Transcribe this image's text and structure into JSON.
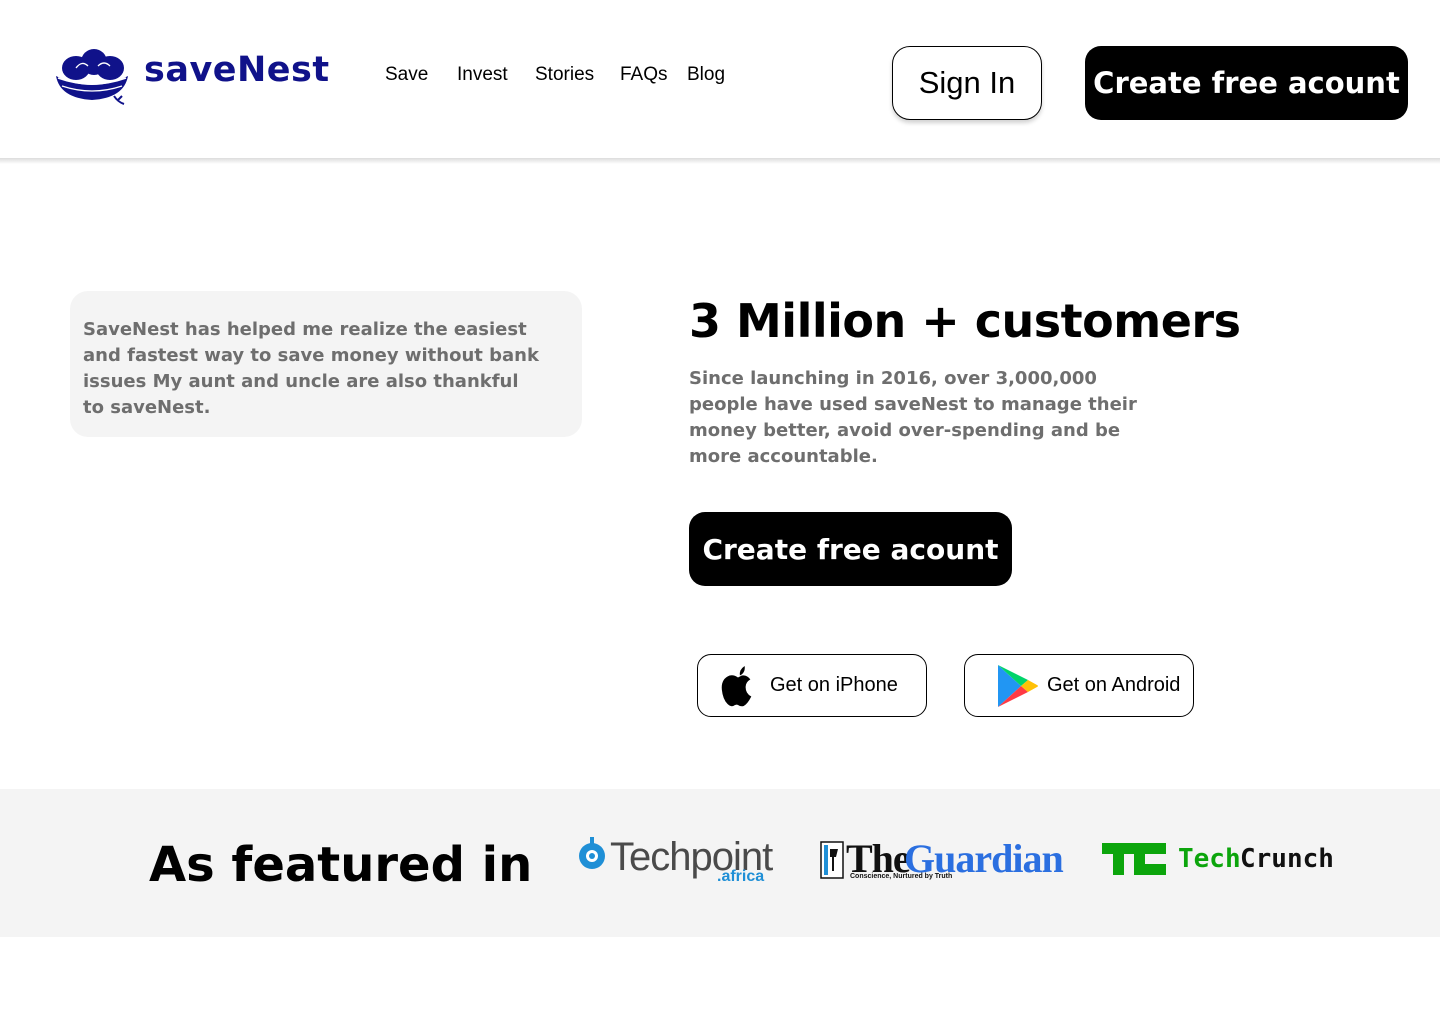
{
  "brand": {
    "name": "saveNest",
    "color": "#10128a",
    "logo_icon": "nest-icon"
  },
  "nav": {
    "items": [
      "Save",
      "Invest",
      "Stories",
      "FAQs",
      "Blog"
    ]
  },
  "header_actions": {
    "sign_in": "Sign In",
    "create_account": "Create free acount"
  },
  "testimonial": {
    "text": "SaveNest has helped me realize the easiest and fastest way to save money without bank issues My aunt and uncle are also thankful to saveNest."
  },
  "hero": {
    "headline": "3 Million + customers",
    "subtext": "Since launching in 2016, over 3,000,000 people have used saveNest to manage their money better, avoid over-spending and be more accountable.",
    "cta": "Create free acount"
  },
  "downloads": {
    "iphone": {
      "label": "Get on iPhone",
      "icon": "apple-icon"
    },
    "android": {
      "label": "Get on Android",
      "icon": "google-play-icon"
    }
  },
  "featured": {
    "title": "As featured in",
    "logos": {
      "techpoint": {
        "main": "Techpoint",
        "sub": ".africa",
        "color": "#1f8fd6"
      },
      "guardian": {
        "the": "The",
        "name": "Guardian",
        "tagline": "Conscience, Nurtured by Truth",
        "color": "#2b6fe0"
      },
      "techcrunch": {
        "tech": "Tech",
        "crunch": "Crunch",
        "color": "#0ca50c"
      }
    }
  }
}
